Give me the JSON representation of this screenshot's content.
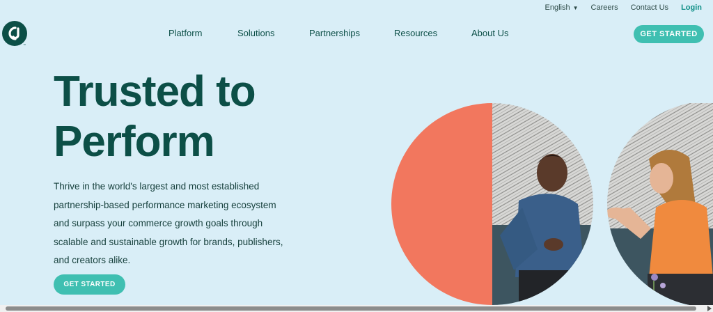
{
  "utility": {
    "language": "English",
    "careers": "Careers",
    "contact": "Contact Us",
    "login": "Login"
  },
  "logo": {
    "icon": "cj-logo-icon",
    "mark": "™"
  },
  "nav": {
    "items": [
      "Platform",
      "Solutions",
      "Partnerships",
      "Resources",
      "About Us"
    ],
    "cta": "GET STARTED"
  },
  "hero": {
    "title_line1": "Trusted to",
    "title_line2": "Perform",
    "body_lines": [
      "Thrive in the world's largest and most established",
      "partnership-based performance marketing ecosystem",
      "and surpass your commerce growth goals through",
      "scalable and sustainable growth for brands, publishers,",
      "and creators alike."
    ],
    "cta": "GET STARTED"
  },
  "colors": {
    "background": "#d9eef7",
    "brand_dark": "#0c4f47",
    "accent_teal": "#3fbfb1",
    "accent_coral": "#f2775e",
    "login": "#0f8f87"
  }
}
